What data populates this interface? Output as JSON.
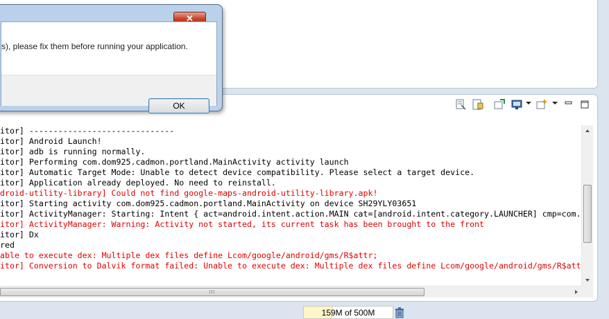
{
  "dialog": {
    "message": "s), please fix them before running your application.",
    "ok_label": "OK",
    "close_glyph": "✕"
  },
  "console": {
    "lines": [
      {
        "text": "itor] ------------------------------",
        "kind": "info"
      },
      {
        "text": "itor] Android Launch!",
        "kind": "info"
      },
      {
        "text": "itor] adb is running normally.",
        "kind": "info"
      },
      {
        "text": "itor] Performing com.dom925.cadmon.portland.MainActivity activity launch",
        "kind": "info"
      },
      {
        "text": "itor] Automatic Target Mode: Unable to detect device compatibility. Please select a target device.",
        "kind": "info"
      },
      {
        "text": "itor] Application already deployed. No need to reinstall.",
        "kind": "info"
      },
      {
        "text": "droid-utility-library] Could not find google-maps-android-utility-library.apk!",
        "kind": "err"
      },
      {
        "text": "itor] Starting activity com.dom925.cadmon.portland.MainActivity on device SH29YLY03651",
        "kind": "info"
      },
      {
        "text": "itor] ActivityManager: Starting: Intent { act=android.intent.action.MAIN cat=[android.intent.category.LAUNCHER] cmp=com.",
        "kind": "info"
      },
      {
        "text": "itor] ActivityManager: Warning: Activity not started, its current task has been brought to the front",
        "kind": "err"
      },
      {
        "text": "itor] Dx",
        "kind": "info"
      },
      {
        "text": "red",
        "kind": "info"
      },
      {
        "text": "able to execute dex: Multiple dex files define Lcom/google/android/gms/R$attr;",
        "kind": "err"
      },
      {
        "text": "itor] Conversion to Dalvik format failed: Unable to execute dex: Multiple dex files define Lcom/google/android/gms/R$att",
        "kind": "err"
      }
    ],
    "toolbar_icons": [
      "clear-console-icon",
      "scroll-lock-icon",
      "pin-console-icon",
      "display-console-icon",
      "open-console-icon",
      "minimize-icon",
      "maximize-icon"
    ],
    "hscroll_grip": "III"
  },
  "status": {
    "heap_label": "159M of 500M",
    "heap_used_fraction": 0.32
  },
  "colors": {
    "error_text": "#e00000",
    "info_text": "#000000",
    "dialog_frame": "#b9d1ea",
    "close_button": "#c4432a"
  }
}
